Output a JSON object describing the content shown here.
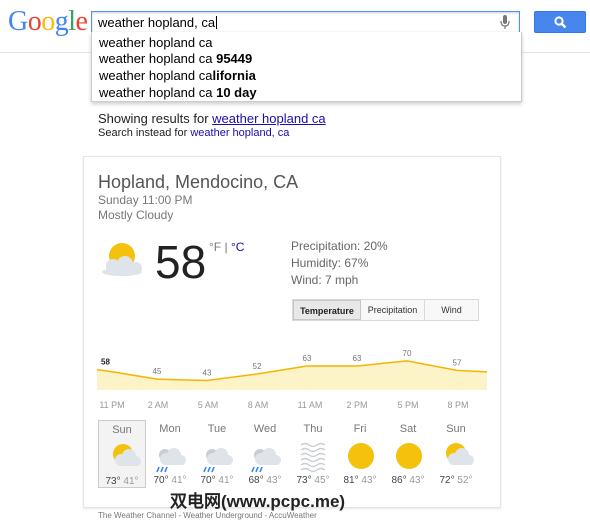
{
  "logo": [
    "G",
    "o",
    "o",
    "g",
    "l",
    "e"
  ],
  "search": {
    "query": "weather hopland, ca"
  },
  "suggestions": [
    {
      "plain": "weather hopland ca",
      "bold": ""
    },
    {
      "plain": "weather hopland ca ",
      "bold": "95449"
    },
    {
      "plain": "weather hopland ca",
      "bold": "lifornia"
    },
    {
      "plain": "weather hopland ca ",
      "bold": "10 day"
    }
  ],
  "results_notice": {
    "showing_prefix": "Showing results for ",
    "showing_link": "weather hopland ca",
    "instead_prefix": "Search instead for ",
    "instead_link": "weather hopland, ca"
  },
  "weather": {
    "location": "Hopland, Mendocino, CA",
    "datetime": "Sunday 11:00 PM",
    "condition": "Mostly Cloudy",
    "temp": "58",
    "unit_f": "°F",
    "unit_sep": " | ",
    "unit_c": "°C",
    "precipitation": "Precipitation: 20%",
    "humidity": "Humidity: 67%",
    "wind": "Wind: 7 mph",
    "tabs": [
      "Temperature",
      "Precipitation",
      "Wind"
    ],
    "active_tab": "Temperature",
    "colors": {
      "chart_fill": "#fdf3c8",
      "chart_line": "#f4b400",
      "sun": "#f4c20d",
      "cloud": "#dfe4ea",
      "rain": "#3b82f6"
    },
    "times": [
      "11 PM",
      "2 AM",
      "5 AM",
      "8 AM",
      "11 AM",
      "2 PM",
      "5 PM",
      "8 PM"
    ],
    "days": [
      {
        "name": "Sun",
        "hi": "73°",
        "lo": "41°",
        "icon": "partly-cloudy-icon"
      },
      {
        "name": "Mon",
        "hi": "70°",
        "lo": "41°",
        "icon": "rain-cloud-icon"
      },
      {
        "name": "Tue",
        "hi": "70°",
        "lo": "41°",
        "icon": "rain-cloud-icon"
      },
      {
        "name": "Wed",
        "hi": "68°",
        "lo": "43°",
        "icon": "rain-cloud-icon"
      },
      {
        "name": "Thu",
        "hi": "73°",
        "lo": "45°",
        "icon": "fog-icon"
      },
      {
        "name": "Fri",
        "hi": "81°",
        "lo": "43°",
        "icon": "sun-icon"
      },
      {
        "name": "Sat",
        "hi": "86°",
        "lo": "43°",
        "icon": "sun-icon"
      },
      {
        "name": "Sun",
        "hi": "72°",
        "lo": "52°",
        "icon": "partly-cloudy-icon"
      }
    ],
    "footer": "The Weather Channel - Weather Underground - AccuWeather"
  },
  "chart_data": {
    "type": "area",
    "x": [
      "11 PM",
      "12 AM",
      "2 AM",
      "3 AM",
      "5 AM",
      "8 AM",
      "11 AM",
      "2 PM",
      "5 PM",
      "8 PM",
      "10 PM"
    ],
    "values": [
      58,
      54,
      45,
      44,
      43,
      52,
      63,
      63,
      70,
      57,
      55
    ],
    "labels": [
      "58",
      "45",
      "43",
      "52",
      "63",
      "63",
      "70",
      "57"
    ],
    "ylim": [
      30,
      85
    ]
  },
  "watermark": "双电网(www.pcpc.me)"
}
